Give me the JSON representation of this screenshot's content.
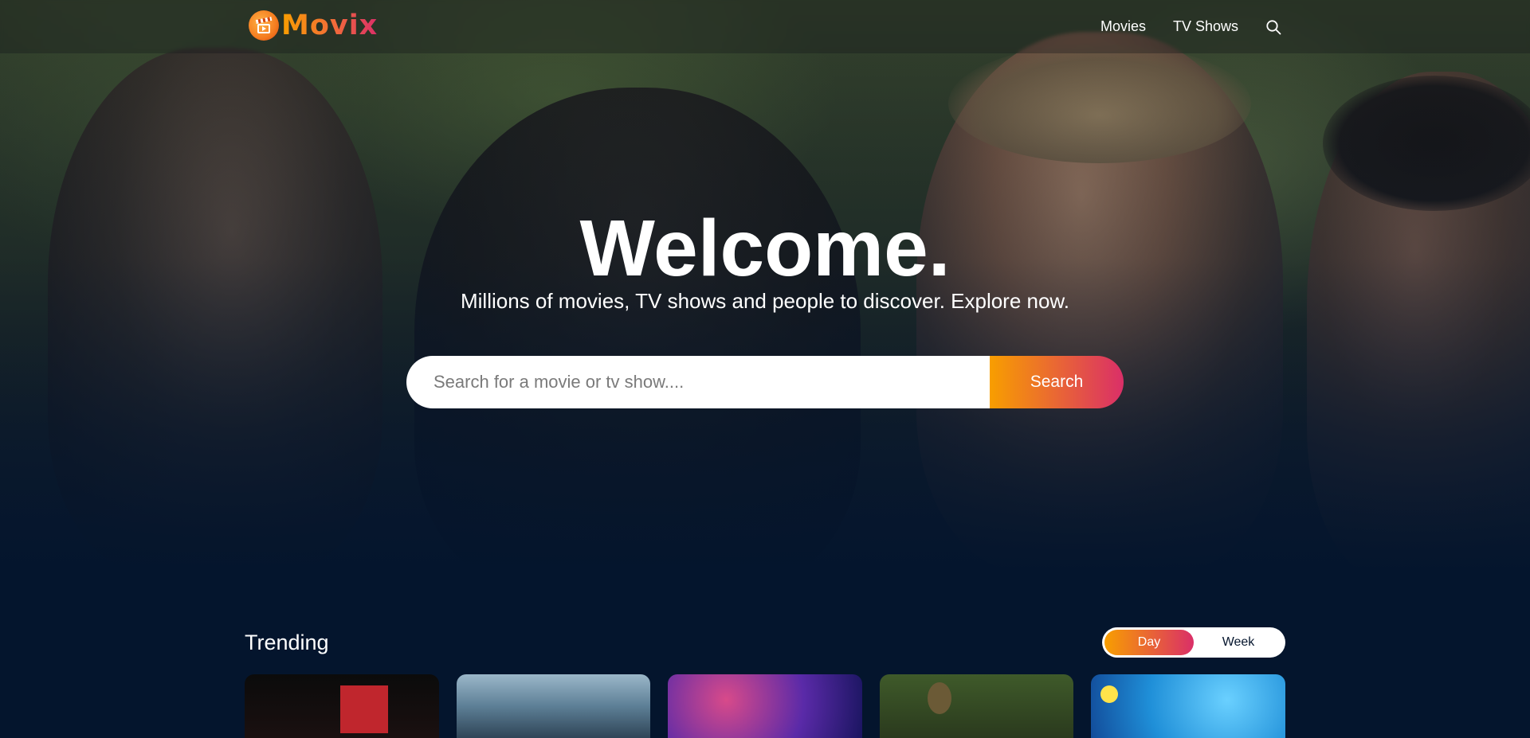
{
  "header": {
    "logo_text": "Movix",
    "nav": [
      {
        "label": "Movies"
      },
      {
        "label": "TV Shows"
      }
    ],
    "search_icon": "search-icon"
  },
  "hero": {
    "title": "Welcome.",
    "subtitle": "Millions of movies, TV shows and people to discover. Explore now.",
    "search": {
      "placeholder": "Search for a movie or tv show....",
      "button_label": "Search"
    }
  },
  "trending": {
    "title": "Trending",
    "tabs": [
      {
        "label": "Day",
        "active": true
      },
      {
        "label": "Week",
        "active": false
      }
    ],
    "card_count": 5
  },
  "colors": {
    "background": "#04152d",
    "gradient_start": "#f89e00",
    "gradient_end": "#da2f68"
  }
}
